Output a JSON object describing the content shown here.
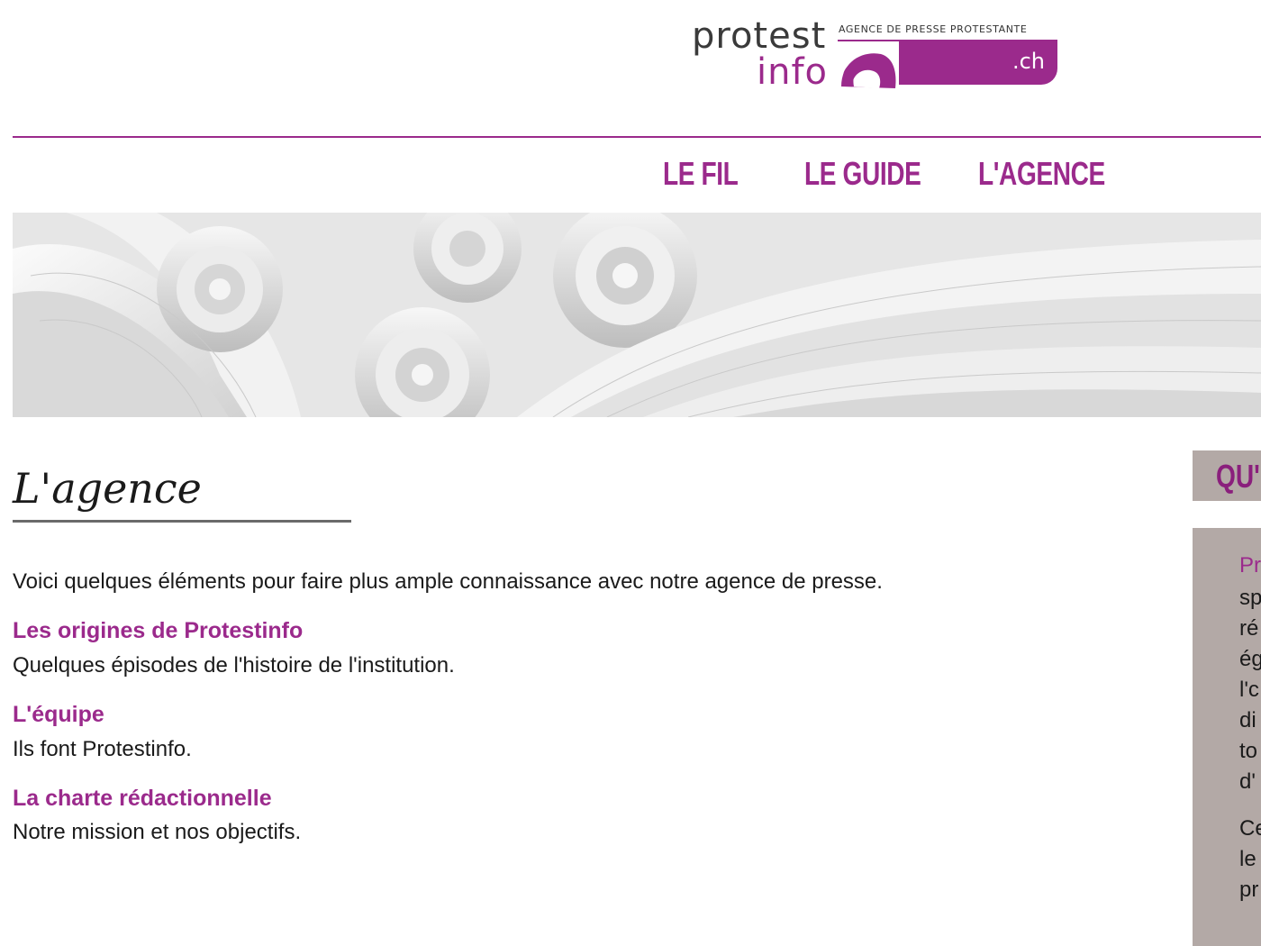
{
  "header": {
    "logo_word_1": "protest",
    "logo_word_2": "info",
    "logo_tagline": "AGENCE DE PRESSE PROTESTANTE",
    "logo_domain": ".ch"
  },
  "nav": {
    "items": [
      {
        "label": "LE FIL"
      },
      {
        "label": "LE GUIDE"
      },
      {
        "label": "L'AGENCE"
      }
    ]
  },
  "main": {
    "title": "L'agence",
    "intro": "Voici quelques éléments pour faire plus ample connaissance avec notre agence de presse.",
    "sections": [
      {
        "link": "Les origines de Protestinfo",
        "description": "Quelques épisodes de l'histoire de l'institution."
      },
      {
        "link": "L'équipe",
        "description": "Ils font Protestinfo."
      },
      {
        "link": "La charte rédactionnelle",
        "description": "Notre mission et nos objectifs."
      }
    ]
  },
  "sidebar": {
    "heading": "QU'",
    "lines": [
      "Pr",
      "sp",
      "ré",
      "ég",
      "l'c",
      "di",
      "to",
      "d'",
      "Ce",
      "le",
      "pr"
    ]
  },
  "colors": {
    "accent": "#9b2a8c",
    "sidebar_bg": "#b3a9a6",
    "text": "#1a1a1a"
  }
}
